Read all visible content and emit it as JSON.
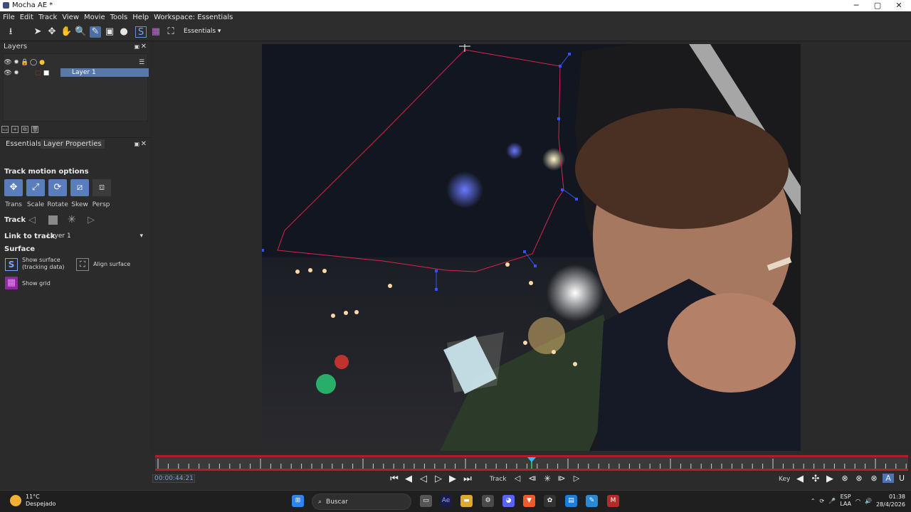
{
  "window": {
    "title": "Mocha AE *",
    "minimize": "─",
    "restore": "▢",
    "close": "✕"
  },
  "menu": [
    "File",
    "Edit",
    "Track",
    "View",
    "Movie",
    "Tools",
    "Help",
    "Workspace: Essentials"
  ],
  "toolbar": {
    "workspace_select": "Essentials"
  },
  "layers_panel": {
    "title": "Layers",
    "layer_name": "Layer 1"
  },
  "tabs": [
    "Essentials",
    "Layer Properties"
  ],
  "props": {
    "track_motion_title": "Track motion options",
    "motion_options": [
      "Trans",
      "Scale",
      "Rotate",
      "Skew",
      "Persp"
    ],
    "track_label": "Track",
    "link_label": "Link to track",
    "link_value": "Layer 1",
    "surface_title": "Surface",
    "show_surface": "Show surface\n(tracking data)",
    "align_surface": "Align surface",
    "show_grid": "Show grid"
  },
  "timeline": {
    "timecode": "00:00:44:21",
    "track_label": "Track",
    "key_label": "Key"
  },
  "taskbar": {
    "temp": "11°C",
    "condition": "Despejado",
    "search": "Buscar",
    "lang": "ESP",
    "layout": "LAA",
    "time": "01:38",
    "date": "28/4/2026"
  }
}
